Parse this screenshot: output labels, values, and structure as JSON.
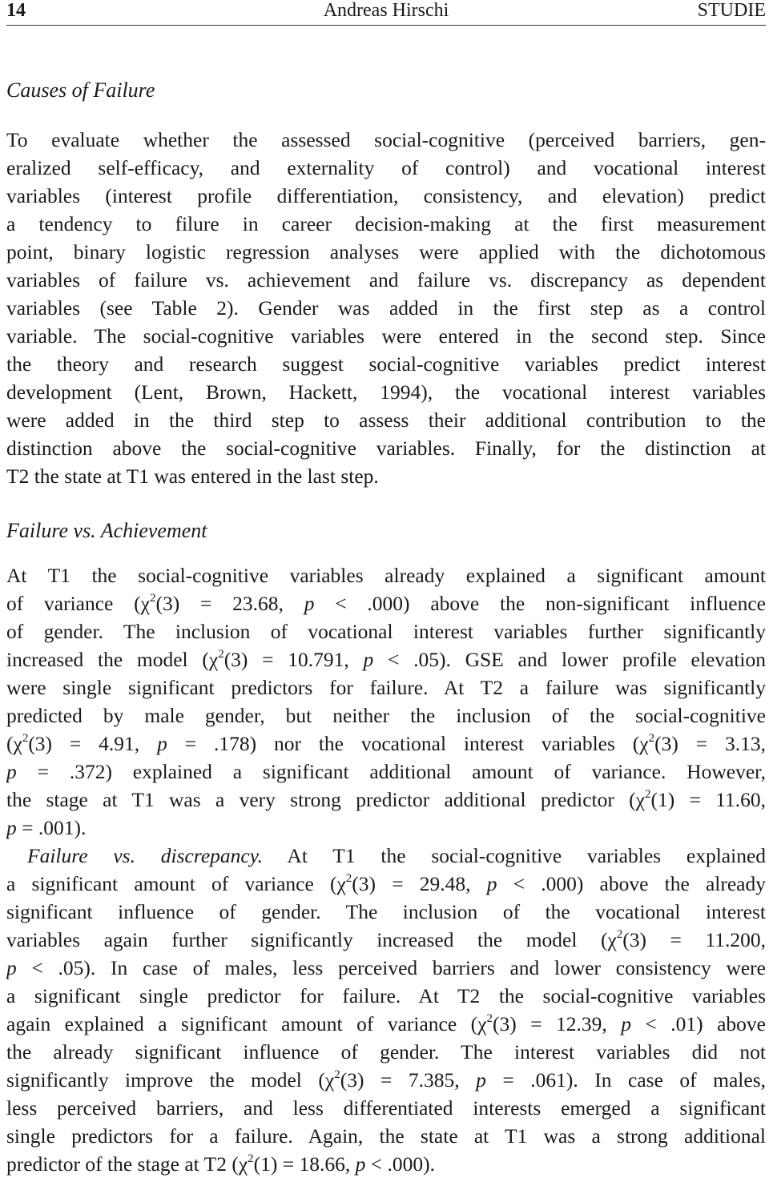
{
  "header": {
    "page_number": "14",
    "author": "Andreas Hirschi",
    "journal": "STUDIE"
  },
  "section": {
    "title": "Causes of Failure",
    "paragraph_lines": [
      "To evaluate whether the assessed social-cognitive (perceived barriers, gen-",
      "eralized self-efficacy, and externality of control) and vocational interest",
      "variables (interest profile differentiation, consistency, and elevation) predict",
      "a tendency to filure in career decision-making at the first measurement",
      "point, binary logistic regression analyses were applied with the dichotomous",
      "variables of failure vs. achievement and failure vs. discrepancy as dependent",
      "variables (see Table 2).  Gender was added in the first step as a control",
      "variable. The social-cognitive variables were entered in the second step. Since",
      "the theory and research suggest social-cognitive variables predict interest",
      "development (Lent, Brown, Hackett, 1994), the vocational interest variables",
      "were added in the third step to assess their additional contribution to the",
      "distinction above the social-cognitive variables. Finally, for the distinction at",
      "T2 the state at T1 was entered in the last step."
    ]
  },
  "subsection": {
    "title": "Failure vs. Achievement",
    "lines": [
      {
        "html": "At T1 the social-cognitive variables already explained a significant amount"
      },
      {
        "html": "of variance (χ<sup>2</sup>(3) = 23.68, <i>p</i> &lt; .000) above the non-significant influence"
      },
      {
        "html": "of gender. The inclusion of vocational interest variables further significantly"
      },
      {
        "html": "increased the model (χ<sup>2</sup>(3) = 10.791, <i>p</i> &lt; .05). GSE and lower profile elevation"
      },
      {
        "html": "were single significant predictors for failure. At T2 a failure was significantly"
      },
      {
        "html": "predicted by male gender, but neither the inclusion of the social-cognitive"
      },
      {
        "html": "(χ<sup>2</sup>(3) = 4.91, <i>p</i> = .178) nor the vocational interest variables (χ<sup>2</sup>(3) = 3.13,"
      },
      {
        "html": "<i>p</i> = .372) explained a significant additional amount of variance.  However,"
      },
      {
        "html": "the stage at T1 was a very strong predictor additional predictor (χ<sup>2</sup>(1) = 11.60,"
      },
      {
        "html": "<i>p</i> = .001)."
      }
    ]
  },
  "discrepancy": {
    "run_in_title": "Failure vs. discrepancy.",
    "lines": [
      {
        "html": "At T1 the social-cognitive variables explained"
      },
      {
        "html": "a significant amount of variance (χ<sup>2</sup>(3) = 29.48, <i>p</i> &lt; .000) above the already"
      },
      {
        "html": "significant influence of gender.  The inclusion of the vocational interest"
      },
      {
        "html": "variables again further significantly increased the model (χ<sup>2</sup>(3) = 11.200,"
      },
      {
        "html": "<i>p</i> &lt; .05). In case of males, less perceived barriers and lower consistency were"
      },
      {
        "html": "a significant single predictor for failure. At T2 the social-cognitive variables"
      },
      {
        "html": "again explained a significant amount of variance (χ<sup>2</sup>(3) = 12.39, <i>p</i> &lt; .01) above"
      },
      {
        "html": "the already significant influence of gender.  The interest variables did not"
      },
      {
        "html": "significantly improve the model (χ<sup>2</sup>(3) = 7.385, <i>p</i> = .061). In case of males,"
      },
      {
        "html": "less perceived barriers, and less differentiated interests emerged a significant"
      },
      {
        "html": "single predictors for a failure. Again, the state at T1 was a strong additional"
      },
      {
        "html": "predictor of the stage at T2 (χ<sup>2</sup>(1) = 18.66, <i>p</i> &lt; .000)."
      }
    ]
  }
}
